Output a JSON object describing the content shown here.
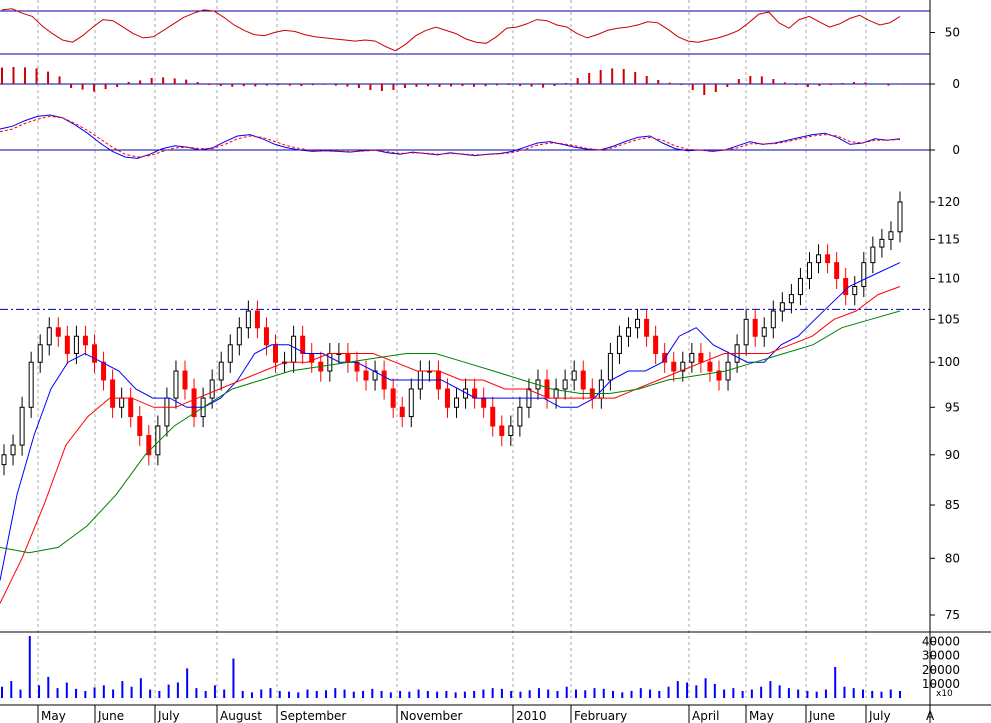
{
  "colors": {
    "price_up": "#000000",
    "price_down": "#ff0000",
    "ma_short": "#0000ff",
    "ma_mid": "#ff0000",
    "ma_long": "#008000",
    "oscillator": "#cc0000",
    "volume": "#0000ff",
    "reference_line": "#0000aa",
    "grid": "#aaaaaa"
  },
  "chart_data": [
    {
      "panel": "oscillator",
      "type": "line",
      "y_ticks": [
        "50"
      ],
      "y_tick_values": [
        50
      ],
      "ylim": [
        0,
        100
      ],
      "reference_levels": [
        30,
        70
      ],
      "series": [
        {
          "color": "#cc0000",
          "values": [
            71,
            72,
            68,
            65,
            56,
            49,
            43,
            41,
            47,
            55,
            62,
            61,
            55,
            49,
            45,
            46,
            52,
            58,
            64,
            68,
            71,
            70,
            64,
            57,
            52,
            48,
            47,
            50,
            52,
            51,
            48,
            46,
            45,
            44,
            43,
            42,
            43,
            42,
            37,
            33,
            39,
            47,
            52,
            55,
            52,
            49,
            44,
            41,
            40,
            46,
            54,
            55,
            58,
            62,
            61,
            57,
            55,
            49,
            45,
            48,
            52,
            54,
            55,
            57,
            60,
            59,
            53,
            46,
            42,
            41,
            43,
            45,
            48,
            52,
            59,
            67,
            69,
            59,
            54,
            62,
            65,
            60,
            55,
            58,
            63,
            66,
            61,
            57,
            59,
            65
          ]
        }
      ]
    },
    {
      "panel": "histogram",
      "type": "bar",
      "y_ticks": [
        "0"
      ],
      "y_tick_values": [
        0
      ],
      "ylim": [
        -1,
        1
      ],
      "series": [
        {
          "color": "#cc0000",
          "values": [
            0.82,
            0.85,
            0.83,
            0.78,
            0.62,
            0.38,
            -0.2,
            -0.28,
            -0.38,
            -0.25,
            -0.15,
            0.1,
            0.18,
            0.3,
            0.33,
            0.28,
            0.22,
            0.1,
            -0.05,
            -0.1,
            -0.14,
            -0.11,
            -0.12,
            -0.08,
            -0.05,
            -0.08,
            -0.1,
            -0.06,
            -0.04,
            -0.08,
            -0.13,
            -0.2,
            -0.3,
            -0.35,
            -0.3,
            -0.2,
            -0.14,
            -0.11,
            -0.15,
            -0.12,
            -0.1,
            -0.14,
            -0.11,
            -0.07,
            -0.05,
            -0.1,
            -0.13,
            -0.18,
            -0.1,
            0.05,
            0.3,
            0.55,
            0.7,
            0.78,
            0.75,
            0.6,
            0.4,
            0.2,
            0.07,
            -0.05,
            -0.3,
            -0.55,
            -0.4,
            -0.15,
            0.25,
            0.4,
            0.38,
            0.25,
            0.08,
            -0.05,
            -0.15,
            -0.1,
            -0.05,
            0.05,
            0.1,
            0.08,
            -0.02,
            -0.08,
            0.02
          ]
        }
      ]
    },
    {
      "panel": "macd",
      "type": "line",
      "y_ticks": [
        "0"
      ],
      "y_tick_values": [
        0
      ],
      "ylim": [
        -1.2,
        2.8
      ],
      "series": [
        {
          "color": "#0000ff",
          "values": [
            1.5,
            1.7,
            2.1,
            2.4,
            2.5,
            2.3,
            1.8,
            1.2,
            0.5,
            -0.1,
            -0.5,
            -0.6,
            -0.3,
            0.1,
            0.3,
            0.2,
            0.0,
            0.15,
            0.6,
            1.0,
            1.1,
            0.8,
            0.4,
            0.15,
            0.0,
            -0.1,
            -0.05,
            -0.1,
            -0.15,
            -0.05,
            0.0,
            -0.2,
            -0.3,
            -0.15,
            -0.25,
            -0.35,
            -0.2,
            -0.3,
            -0.4,
            -0.3,
            -0.25,
            -0.1,
            0.2,
            0.5,
            0.6,
            0.4,
            0.2,
            0.05,
            0.0,
            0.25,
            0.6,
            0.9,
            1.0,
            0.5,
            0.1,
            -0.05,
            0.0,
            -0.1,
            0.0,
            0.3,
            0.6,
            0.4,
            0.5,
            0.7,
            0.9,
            1.1,
            1.2,
            0.9,
            0.4,
            0.5,
            0.8,
            0.7,
            0.8
          ]
        },
        {
          "color": "#ff0000",
          "values": [
            1.3,
            1.5,
            1.9,
            2.2,
            2.4,
            2.3,
            1.9,
            1.4,
            0.8,
            0.2,
            -0.3,
            -0.5,
            -0.4,
            -0.1,
            0.15,
            0.2,
            0.1,
            0.1,
            0.4,
            0.8,
            1.0,
            0.9,
            0.6,
            0.3,
            0.1,
            -0.05,
            -0.05,
            -0.08,
            -0.12,
            -0.08,
            -0.03,
            -0.12,
            -0.25,
            -0.2,
            -0.22,
            -0.3,
            -0.25,
            -0.28,
            -0.35,
            -0.32,
            -0.28,
            -0.18,
            0.05,
            0.35,
            0.5,
            0.45,
            0.3,
            0.1,
            0.02,
            0.15,
            0.45,
            0.75,
            0.9,
            0.7,
            0.3,
            0.05,
            0.0,
            -0.05,
            -0.02,
            0.15,
            0.45,
            0.45,
            0.45,
            0.6,
            0.8,
            1.0,
            1.1,
            1.0,
            0.6,
            0.5,
            0.7,
            0.7,
            0.75
          ]
        }
      ]
    },
    {
      "panel": "price",
      "type": "candlestick",
      "y_ticks": [
        "120",
        "115",
        "110",
        "105",
        "100",
        "95",
        "90",
        "85",
        "80",
        "75"
      ],
      "y_tick_values": [
        120,
        115,
        110,
        105,
        100,
        95,
        90,
        85,
        80,
        75
      ],
      "y_scale": "log",
      "ylim": [
        72.5,
        124
      ],
      "horizontal_reference": 106.2,
      "close": [
        90,
        91,
        95,
        100,
        102,
        104,
        103,
        101,
        103,
        102,
        100,
        98,
        95,
        96,
        94,
        92,
        90,
        93,
        96,
        99,
        97,
        94,
        96,
        98,
        100,
        102,
        104,
        106,
        104,
        102,
        100,
        100,
        103,
        101,
        100,
        99,
        101,
        101,
        100,
        99,
        98,
        99,
        97,
        95,
        94,
        97,
        99,
        99,
        97,
        95,
        96,
        97,
        96,
        95,
        93,
        92,
        93,
        95,
        97,
        98,
        96,
        97,
        98,
        99,
        97,
        96,
        98,
        101,
        103,
        104,
        105,
        103,
        101,
        100,
        99,
        100,
        101,
        100,
        99,
        98,
        100,
        102,
        105,
        103,
        104,
        106,
        107,
        108,
        110,
        112,
        113,
        112,
        110,
        108,
        109,
        112,
        114,
        115,
        116,
        120
      ],
      "series": [
        {
          "color": "#0000ff",
          "values": [
            78,
            86,
            92,
            97,
            100,
            101,
            100,
            99,
            97,
            96,
            96,
            95,
            95,
            96,
            98,
            101,
            102,
            102,
            101,
            101,
            100,
            100,
            99,
            98,
            98,
            98,
            98,
            97,
            96,
            96,
            96,
            96,
            96,
            95,
            95,
            96,
            98,
            99,
            99,
            100,
            103,
            104,
            102,
            101,
            100,
            100,
            102,
            103,
            105,
            107,
            109,
            110,
            111,
            112
          ]
        },
        {
          "color": "#ff0000",
          "values": [
            76,
            80,
            85,
            91,
            94,
            96,
            96,
            95,
            95,
            96,
            97,
            98,
            99,
            100,
            100,
            101,
            101,
            101,
            100,
            99,
            99,
            98,
            98,
            97,
            97,
            96,
            96,
            96,
            96,
            97,
            98,
            99,
            100,
            101,
            101,
            101,
            102,
            103,
            105,
            106,
            108,
            109
          ]
        },
        {
          "color": "#008000",
          "values": [
            81,
            80.5,
            81,
            83,
            86,
            90,
            93,
            95,
            97,
            98,
            99,
            99.5,
            100,
            100.5,
            101,
            101,
            100,
            99,
            98,
            97,
            96.5,
            96.5,
            97,
            98,
            98.5,
            99,
            100,
            101,
            102,
            104,
            105,
            106
          ]
        }
      ]
    },
    {
      "panel": "volume",
      "type": "bar",
      "y_ticks": [
        "40000",
        "30000",
        "20000",
        "10000"
      ],
      "y_tick_values": [
        40000,
        30000,
        20000,
        10000
      ],
      "ylim": [
        0,
        45000
      ],
      "unit": "x10",
      "series": [
        {
          "color": "#0000ff",
          "values": [
            8000,
            12000,
            6000,
            44000,
            9000,
            15000,
            7000,
            11000,
            6500,
            5000,
            7500,
            9000,
            6000,
            12000,
            8000,
            14000,
            6000,
            5000,
            9500,
            11000,
            21000,
            7000,
            5000,
            9000,
            6000,
            28000,
            5000,
            4000,
            6000,
            7000,
            5000,
            4500,
            4000,
            6000,
            5000,
            5500,
            7000,
            6000,
            4500,
            5000,
            6500,
            5000,
            4000,
            5000,
            4500,
            6000,
            5000,
            4500,
            5000,
            4000,
            4500,
            5000,
            6000,
            7000,
            6500,
            5000,
            4500,
            5500,
            7000,
            6000,
            5000,
            8000,
            6000,
            5500,
            7000,
            6500,
            5000,
            4000,
            5000,
            7000,
            6000,
            5000,
            8000,
            12000,
            11000,
            9000,
            14000,
            10000,
            6000,
            7000,
            5000,
            6000,
            8000,
            12000,
            9000,
            7000,
            6000,
            5000,
            4500,
            6000,
            22000,
            8000,
            7000,
            6000,
            5000,
            4500,
            6000,
            5000
          ]
        }
      ]
    }
  ],
  "x_axis": {
    "labels": [
      "May",
      "June",
      "July",
      "August",
      "September",
      "November",
      "2010",
      "February",
      "April",
      "May",
      "June",
      "July"
    ],
    "edge_label": "A"
  }
}
